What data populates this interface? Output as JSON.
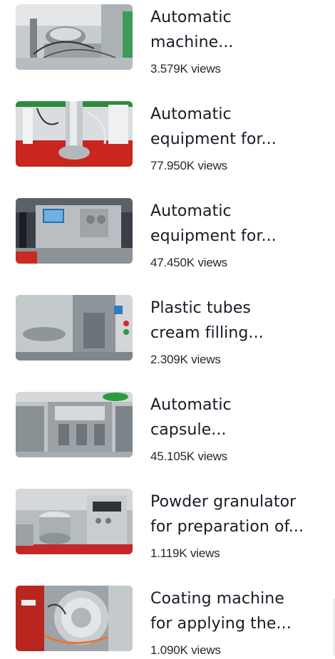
{
  "videos": [
    {
      "title": "Automatic machine...",
      "line1": "Automatic",
      "line2": "machine...",
      "views": "3.579K views",
      "thumb_icon": "metal-machine-thumbnail"
    },
    {
      "title": "Automatic equipment for...",
      "line1": "Automatic",
      "line2": "equipment for...",
      "views": "77.950K views",
      "thumb_icon": "red-floor-machine-thumbnail"
    },
    {
      "title": "Automatic equipment for...",
      "line1": "Automatic",
      "line2": "equipment for...",
      "views": "47.450K views",
      "thumb_icon": "control-panel-machine-thumbnail"
    },
    {
      "title": "Plastic tubes cream filling...",
      "line1": "Plastic tubes",
      "line2": "cream filling...",
      "views": "2.309K views",
      "thumb_icon": "tube-filling-machine-thumbnail"
    },
    {
      "title": "Automatic capsule...",
      "line1": "Automatic",
      "line2": "capsule...",
      "views": "45.105K views",
      "thumb_icon": "capsule-machine-thumbnail"
    },
    {
      "title": "Powder granulator for preparation of...",
      "line1": "Powder granulator",
      "line2": "for preparation of...",
      "views": "1.119K views",
      "thumb_icon": "granulator-thumbnail"
    },
    {
      "title": "Coating machine for applying the...",
      "line1": "Coating machine",
      "line2": "for applying the...",
      "views": "1.090K views",
      "thumb_icon": "coating-machine-thumbnail"
    }
  ],
  "colors": {
    "title": "#1e1826",
    "views": "#2a2530"
  }
}
